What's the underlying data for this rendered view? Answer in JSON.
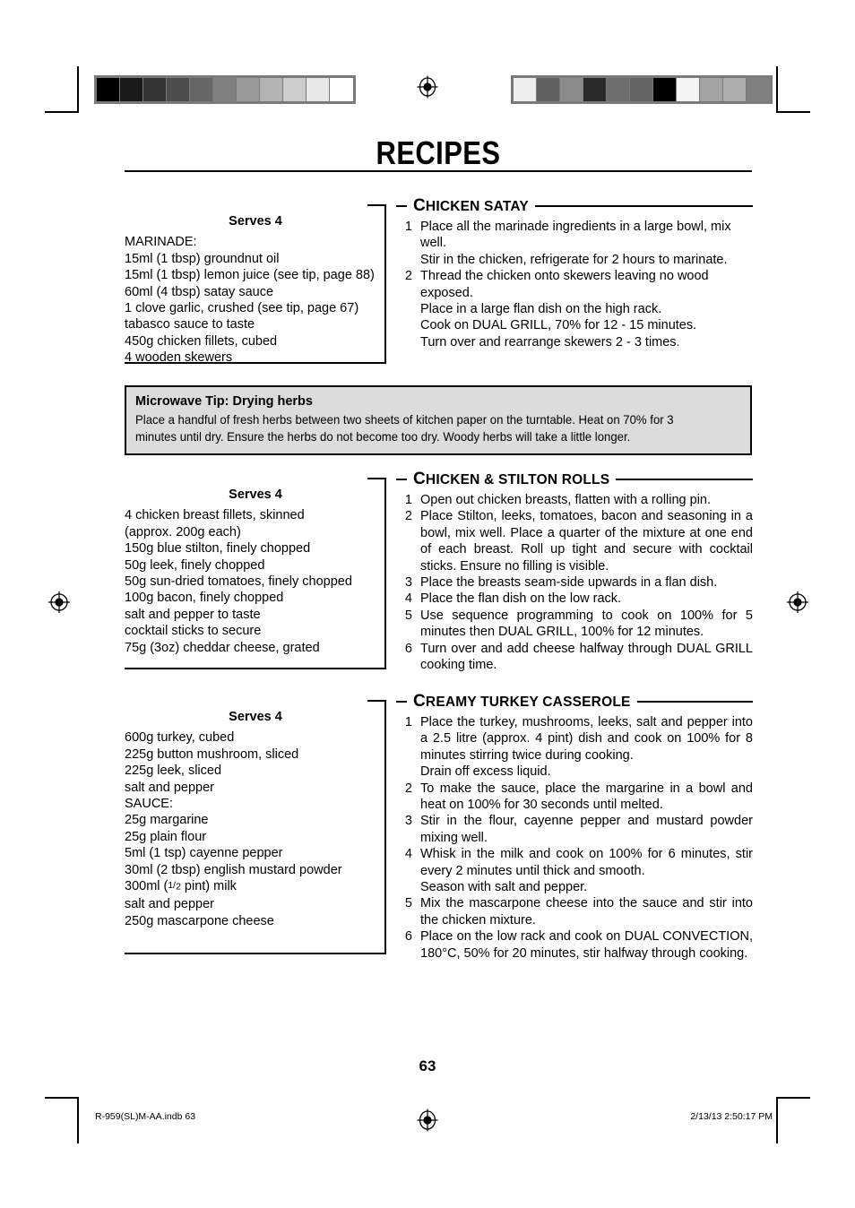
{
  "page_title": "RECIPES",
  "page_number": "63",
  "footer": {
    "left": "R-959(SL)M-AA.indb   63",
    "right": "2/13/13   2:50:17 PM"
  },
  "calibration": {
    "left_strip_colors": [
      "#000000",
      "#1a1a1a",
      "#333333",
      "#4d4d4d",
      "#666666",
      "#808080",
      "#999999",
      "#b3b3b3",
      "#cccccc",
      "#e8e8e8",
      "#ffffff"
    ],
    "right_strip_colors": [
      "#ededed",
      "#616161",
      "#8a8a8a",
      "#2b2b2b",
      "#6e6e6e",
      "#636363",
      "#000000",
      "#f4f4f4",
      "#a3a3a3",
      "#adadad",
      "#808080"
    ]
  },
  "tip": {
    "title": "Microwave Tip: Drying herbs",
    "body": "Place a handful of fresh herbs between two sheets of kitchen paper on the turntable. Heat on 70% for 3 minutes until dry. Ensure the herbs do not become too dry. Woody herbs will take a little longer."
  },
  "recipes": [
    {
      "heading_first": "C",
      "heading_rest": "HICKEN SATAY",
      "serves": "Serves 4",
      "ingredients": [
        "MARINADE:",
        "15ml (1 tbsp) groundnut oil",
        "15ml (1 tbsp) lemon juice (see tip, page 88)",
        "60ml (4 tbsp) satay sauce",
        "1 clove garlic, crushed (see tip, page 67)",
        "tabasco sauce to taste",
        "450g chicken fillets, cubed",
        "4 wooden skewers"
      ],
      "steps": [
        {
          "num": "1",
          "lines": [
            "Place all the marinade ingredients in a large bowl, mix well.",
            "Stir in the chicken, refrigerate for 2 hours to marinate."
          ]
        },
        {
          "num": "2",
          "lines": [
            "Thread the chicken onto skewers leaving no wood exposed.",
            "Place in a large flan dish on the high rack.",
            "Cook on DUAL GRILL, 70% for 12 - 15 minutes.",
            "Turn over and rearrange skewers 2 - 3 times."
          ]
        }
      ]
    },
    {
      "heading_first": "C",
      "heading_rest": "HICKEN & STILTON ROLLS",
      "serves": "Serves 4",
      "ingredients": [
        "4 chicken breast fillets, skinned",
        "(approx. 200g each)",
        "150g blue stilton, finely chopped",
        "50g leek, finely chopped",
        "50g sun-dried tomatoes, finely chopped",
        "100g bacon, finely chopped",
        "salt and pepper to taste",
        "cocktail sticks to secure",
        "75g (3oz) cheddar cheese, grated"
      ],
      "steps": [
        {
          "num": "1",
          "lines": [
            "Open out chicken breasts, flatten with a rolling pin."
          ]
        },
        {
          "num": "2",
          "lines": [
            "Place Stilton, leeks, tomatoes, bacon and seasoning in a bowl, mix well. Place a quarter of the mixture at one end of each breast. Roll up tight and secure with cocktail sticks. Ensure no filling is visible."
          ]
        },
        {
          "num": "3",
          "lines": [
            "Place the breasts seam-side upwards in a flan dish."
          ]
        },
        {
          "num": "4",
          "lines": [
            "Place the flan dish on the low rack."
          ]
        },
        {
          "num": "5",
          "lines": [
            "Use sequence programming to cook on 100% for 5 minutes then DUAL GRILL, 100% for 12 minutes."
          ]
        },
        {
          "num": "6",
          "lines": [
            "Turn over and add cheese halfway through DUAL GRILL cooking time."
          ]
        }
      ]
    },
    {
      "heading_first": "C",
      "heading_rest": "REAMY TURKEY CASSEROLE",
      "serves": "Serves 4",
      "ingredients": [
        "600g turkey, cubed",
        "225g button mushroom, sliced",
        "225g leek, sliced",
        "salt and pepper",
        "SAUCE:",
        "25g margarine",
        "25g plain flour",
        "5ml (1 tsp) cayenne pepper",
        "30ml (2 tbsp) english mustard powder",
        "300ml (1/2 pint) milk",
        "salt and pepper",
        "250g mascarpone cheese"
      ],
      "steps": [
        {
          "num": "1",
          "lines": [
            "Place the turkey, mushrooms, leeks, salt and pepper into a 2.5 litre (approx. 4 pint) dish and cook on 100% for 8 minutes stirring twice during cooking.",
            "Drain off excess liquid."
          ]
        },
        {
          "num": "2",
          "lines": [
            "To make the sauce, place the margarine in a bowl and heat on 100% for 30 seconds until melted."
          ]
        },
        {
          "num": "3",
          "lines": [
            "Stir in the flour, cayenne pepper and mustard powder mixing well."
          ]
        },
        {
          "num": "4",
          "lines": [
            "Whisk in the milk and cook on 100% for 6 minutes, stir every 2 minutes until thick and smooth.",
            "Season with salt and pepper."
          ]
        },
        {
          "num": "5",
          "lines": [
            "Mix the mascarpone cheese into the sauce and stir into the chicken mixture."
          ]
        },
        {
          "num": "6",
          "lines": [
            "Place on the low rack and cook on DUAL CONVECTION, 180°C, 50% for 20 minutes, stir halfway through cooking."
          ]
        }
      ]
    }
  ]
}
